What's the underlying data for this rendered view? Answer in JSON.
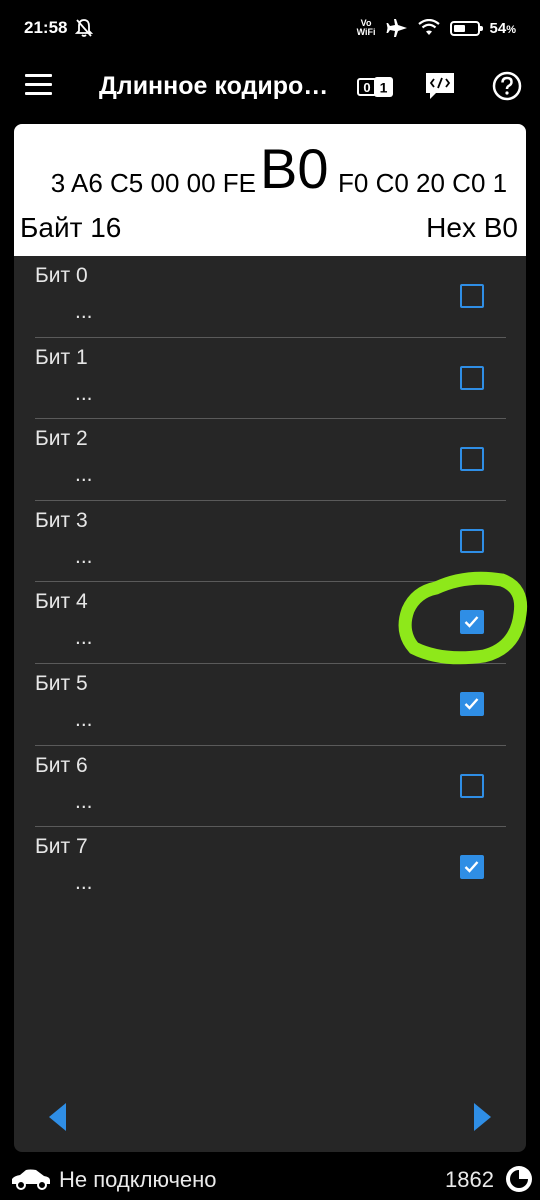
{
  "status_bar": {
    "time": "21:58",
    "vowifi_top": "Vo",
    "vowifi_bottom": "WiFi",
    "battery_percent": "54",
    "battery_suffix": "%",
    "battery_level": 0.54
  },
  "app_bar": {
    "title": "Длинное кодиро…",
    "binary_icon_text": "01"
  },
  "byte_view": {
    "hex_before": "3 A6 C5 00 00 FE",
    "hex_current": "B0",
    "hex_after": "F0 C0 20 C0 1",
    "byte_label": "Байт 16",
    "hex_label": "Hex B0"
  },
  "bits": [
    {
      "label": "Бит 0",
      "desc": "...",
      "checked": false
    },
    {
      "label": "Бит 1",
      "desc": "...",
      "checked": false
    },
    {
      "label": "Бит 2",
      "desc": "...",
      "checked": false
    },
    {
      "label": "Бит 3",
      "desc": "...",
      "checked": false
    },
    {
      "label": "Бит 4",
      "desc": "...",
      "checked": true
    },
    {
      "label": "Бит 5",
      "desc": "...",
      "checked": true
    },
    {
      "label": "Бит 6",
      "desc": "...",
      "checked": false
    },
    {
      "label": "Бит 7",
      "desc": "...",
      "checked": true
    }
  ],
  "bottom_bar": {
    "connection_status": "Не подключено",
    "counter": "1862"
  },
  "colors": {
    "accent": "#2f8ee5",
    "card_bg": "#262626",
    "highlight": "#8ee81a"
  },
  "icons": [
    "menu-icon",
    "binary-icon",
    "code-icon",
    "help-icon",
    "bell-off-icon",
    "airplane-icon",
    "wifi-icon",
    "battery-icon",
    "car-icon",
    "refresh-icon",
    "arrow-left-icon",
    "arrow-right-icon"
  ]
}
